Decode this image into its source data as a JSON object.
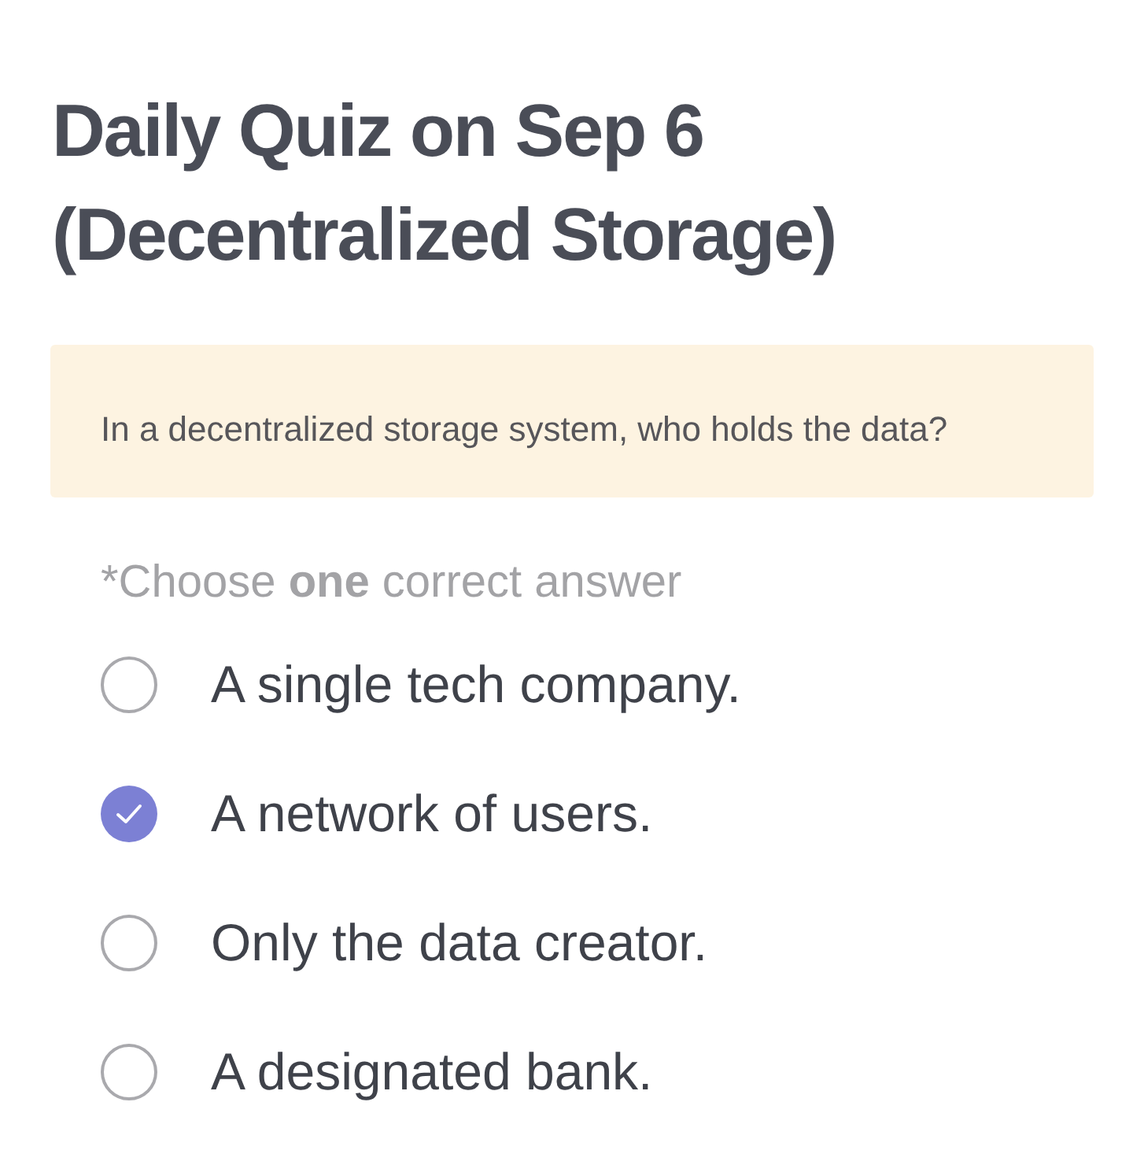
{
  "title": "Daily Quiz on Sep 6 (Decentralized Storage)",
  "question": "In a decentralized storage system, who holds the data?",
  "instruction": "*Choose **one** correct answer",
  "options": [
    {
      "label": "A single tech company.",
      "selected": false
    },
    {
      "label": "A network of users.",
      "selected": true
    },
    {
      "label": "Only the data creator.",
      "selected": false
    },
    {
      "label": "A designated bank.",
      "selected": false
    }
  ]
}
